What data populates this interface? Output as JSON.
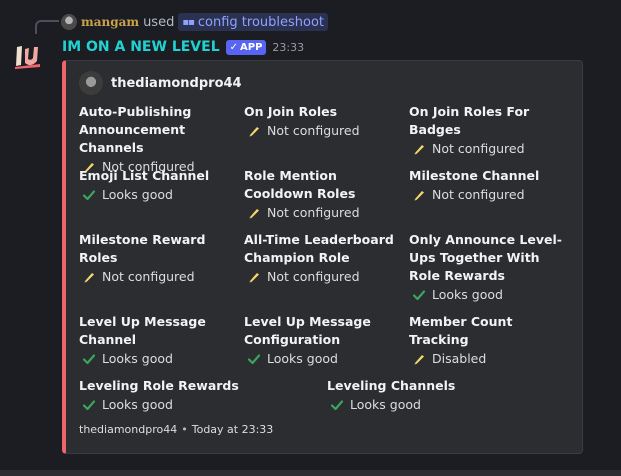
{
  "reply": {
    "username": "mangam",
    "used_text": "used",
    "command": "config troubleshoot"
  },
  "message": {
    "bot_name": "IM ON A NEW LEVEL",
    "badge": "APP",
    "time": "23:33"
  },
  "embed": {
    "accent_color": "#f0646c",
    "author": "thediamondpro44",
    "fields": [
      {
        "name": "Auto-Publishing Announcement Channels",
        "value": "Not configured",
        "icon": "pencil-icon"
      },
      {
        "name": "On Join Roles",
        "value": "Not configured",
        "icon": "pencil-icon"
      },
      {
        "name": "On Join Roles For Badges",
        "value": "Not configured",
        "icon": "pencil-icon"
      },
      {
        "name": "Emoji List Channel",
        "value": "Looks good",
        "icon": "check-icon"
      },
      {
        "name": "Role Mention Cooldown Roles",
        "value": "Not configured",
        "icon": "pencil-icon"
      },
      {
        "name": "Milestone Channel",
        "value": "Not configured",
        "icon": "pencil-icon"
      },
      {
        "name": "Milestone Reward Roles",
        "value": "Not configured",
        "icon": "pencil-icon"
      },
      {
        "name": "All-Time Leaderboard Champion Role",
        "value": "Not configured",
        "icon": "pencil-icon"
      },
      {
        "name": "Only Announce Level-Ups Together With Role Rewards",
        "value": "Looks good",
        "icon": "check-icon"
      },
      {
        "name": "Level Up Message Channel",
        "value": "Looks good",
        "icon": "check-icon"
      },
      {
        "name": "Level Up Message Configuration",
        "value": "Looks good",
        "icon": "check-icon"
      },
      {
        "name": "Member Count Tracking",
        "value": "Disabled",
        "icon": "pencil-icon"
      },
      {
        "name": "Leveling Role Rewards",
        "value": "Looks good",
        "icon": "check-icon"
      },
      {
        "name": "Leveling Channels",
        "value": "Looks good",
        "icon": "check-icon"
      }
    ],
    "footer": {
      "author": "thediamondpro44",
      "separator": "•",
      "time": "Today at 23:33"
    }
  }
}
